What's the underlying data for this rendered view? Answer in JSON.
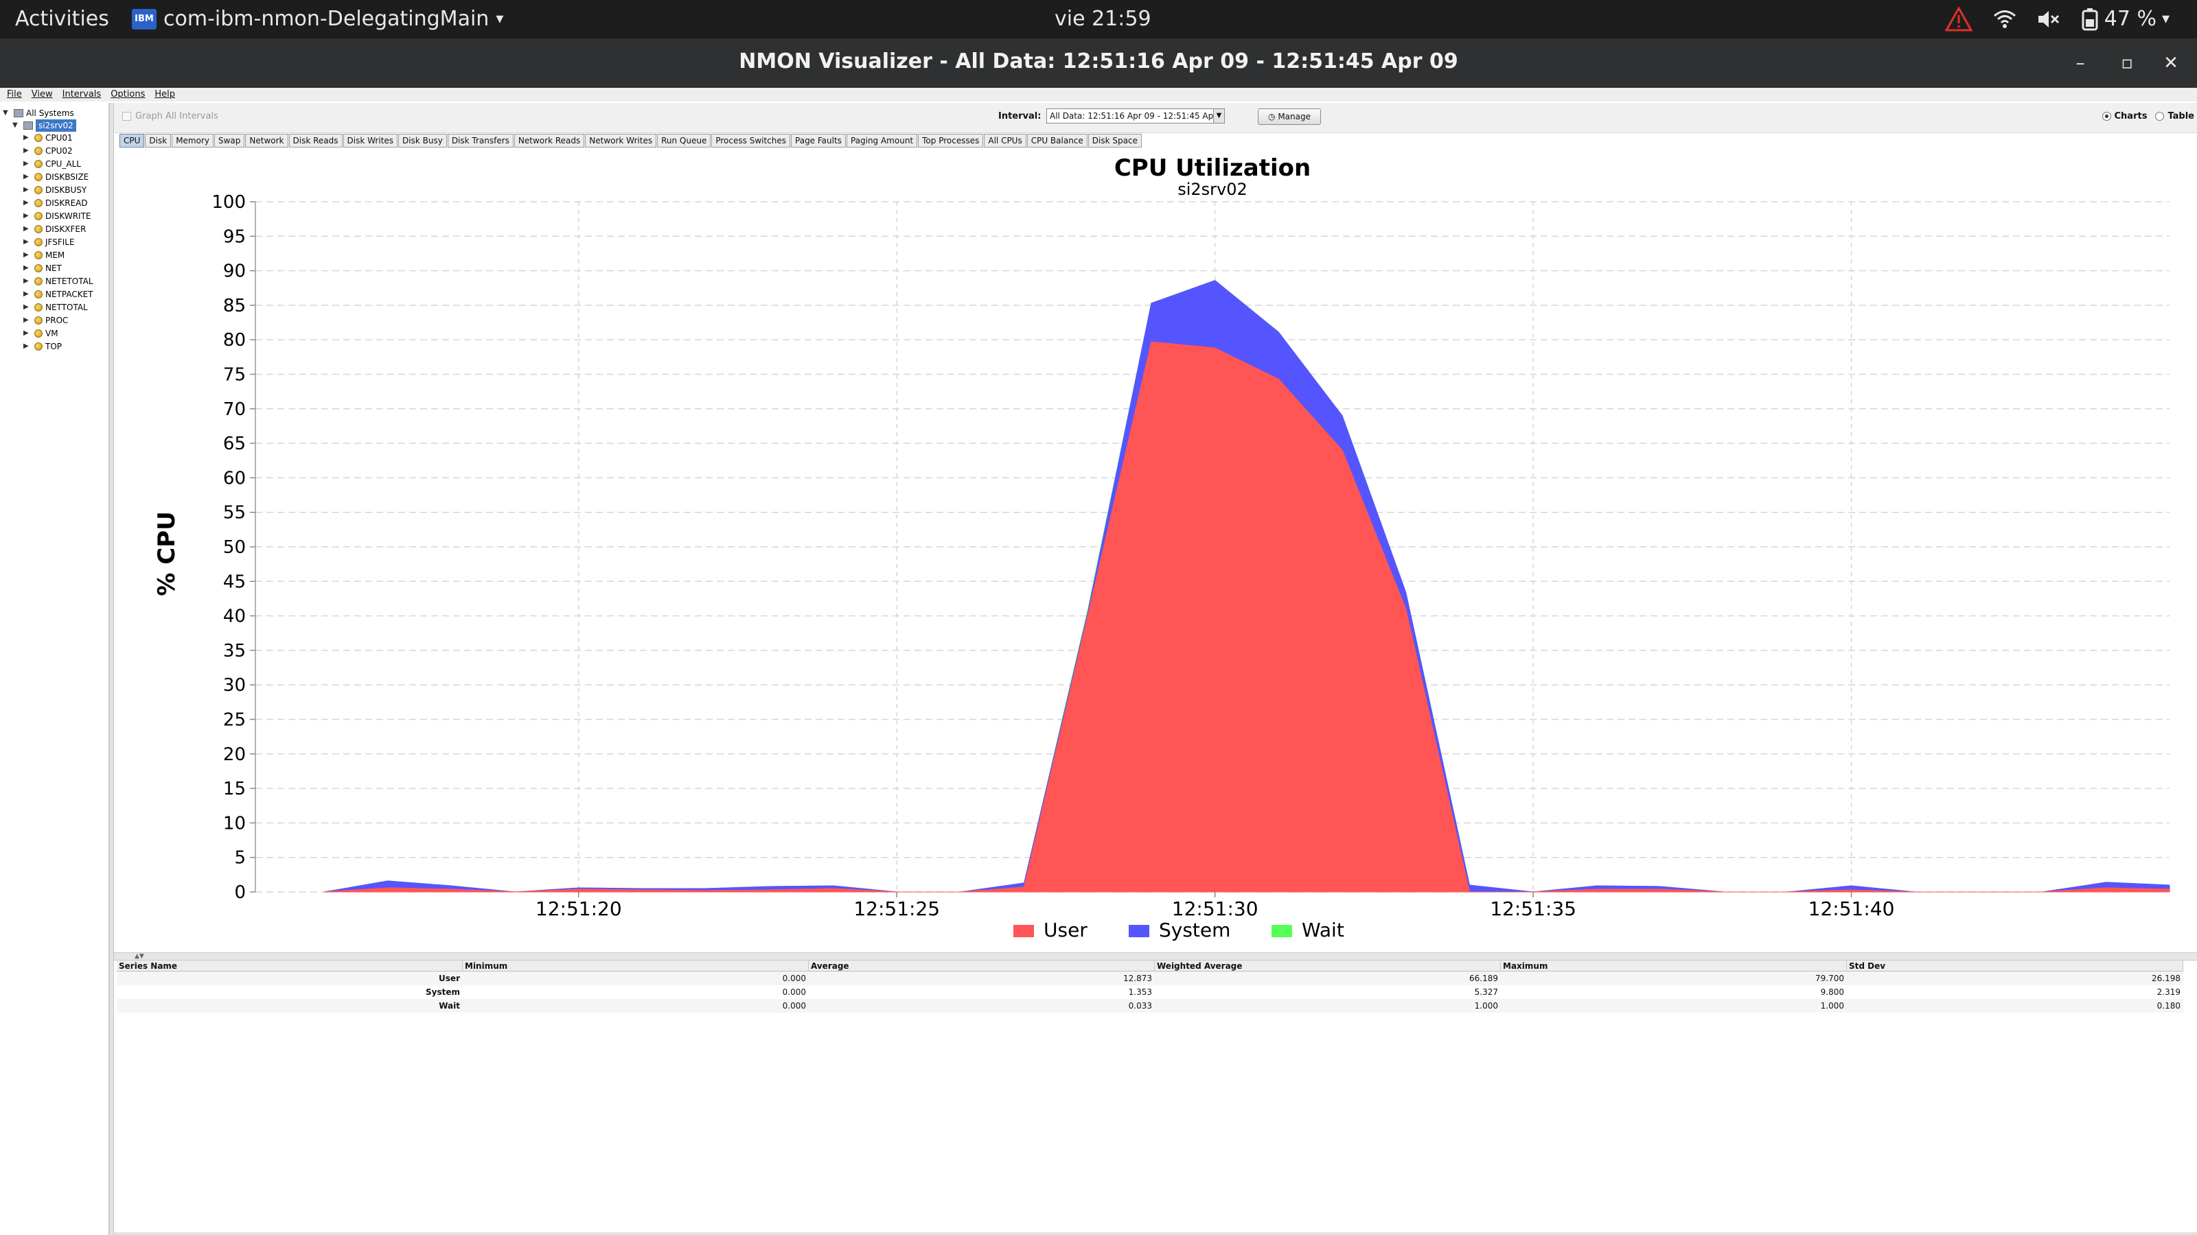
{
  "system_bar": {
    "activities": "Activities",
    "app_name": "com-ibm-nmon-DelegatingMain",
    "app_icon_text": "IBM",
    "clock": "vie 21:59",
    "battery": "47 %"
  },
  "window": {
    "title": "NMON Visualizer - All Data: 12:51:16 Apr 09 - 12:51:45 Apr 09"
  },
  "menu": [
    "File",
    "View",
    "Intervals",
    "Options",
    "Help"
  ],
  "tree": {
    "root": "All Systems",
    "system": "si2srv02",
    "items": [
      "CPU01",
      "CPU02",
      "CPU_ALL",
      "DISKBSIZE",
      "DISKBUSY",
      "DISKREAD",
      "DISKWRITE",
      "DISKXFER",
      "JFSFILE",
      "MEM",
      "NET",
      "NETETOTAL",
      "NETPACKET",
      "NETTOTAL",
      "PROC",
      "VM",
      "TOP"
    ]
  },
  "toolbar": {
    "graph_all": "Graph All Intervals",
    "interval_label": "Interval:",
    "interval_value": "All Data: 12:51:16 Apr 09 - 12:51:45 Apr 09",
    "manage": "Manage",
    "charts": "Charts",
    "table": "Table"
  },
  "tabs": [
    "CPU",
    "Disk",
    "Memory",
    "Swap",
    "Network",
    "Disk Reads",
    "Disk Writes",
    "Disk Busy",
    "Disk Transfers",
    "Network Reads",
    "Network Writes",
    "Run Queue",
    "Process Switches",
    "Page Faults",
    "Paging Amount",
    "Top Processes",
    "All CPUs",
    "CPU Balance",
    "Disk Space"
  ],
  "active_tab": "CPU",
  "chart_data": {
    "type": "area",
    "stacked": true,
    "title": "CPU Utilization",
    "subtitle": "si2srv02",
    "ylabel": "% CPU",
    "xlabel": "",
    "ylim": [
      0,
      100
    ],
    "yticks": [
      0,
      5,
      10,
      15,
      20,
      25,
      30,
      35,
      40,
      45,
      50,
      55,
      60,
      65,
      70,
      75,
      80,
      85,
      90,
      95,
      100
    ],
    "xticks": [
      "12:51:20",
      "12:51:25",
      "12:51:30",
      "12:51:35",
      "12:51:40"
    ],
    "x": [
      "12:51:16",
      "12:51:17",
      "12:51:18",
      "12:51:19",
      "12:51:20",
      "12:51:21",
      "12:51:22",
      "12:51:23",
      "12:51:24",
      "12:51:25",
      "12:51:26",
      "12:51:27",
      "12:51:28",
      "12:51:29",
      "12:51:30",
      "12:51:31",
      "12:51:32",
      "12:51:33",
      "12:51:34",
      "12:51:35",
      "12:51:36",
      "12:51:37",
      "12:51:38",
      "12:51:39",
      "12:51:40",
      "12:51:41",
      "12:51:42",
      "12:51:43",
      "12:51:44",
      "12:51:45"
    ],
    "series": [
      {
        "name": "User",
        "color": "#ff5555",
        "values": [
          0,
          0.6,
          0.4,
          0,
          0.4,
          0.3,
          0.2,
          0.3,
          0.5,
          0,
          0,
          0.7,
          40,
          79.7,
          78.8,
          74.3,
          64.0,
          41.0,
          0,
          0,
          0.4,
          0.4,
          0,
          0,
          0.3,
          0,
          0,
          0,
          0.6,
          0.4
        ]
      },
      {
        "name": "System",
        "color": "#5555ff",
        "values": [
          0,
          1.0,
          0.5,
          0,
          0.2,
          0.2,
          0.3,
          0.5,
          0.4,
          0,
          0,
          0.6,
          0.5,
          5.6,
          9.8,
          6.8,
          5.0,
          2.4,
          1.0,
          0,
          0.5,
          0.4,
          0,
          0,
          0.6,
          0,
          0,
          0,
          0.8,
          0.6
        ]
      },
      {
        "name": "Wait",
        "color": "#55ff55",
        "values": [
          0,
          0,
          0,
          0,
          0,
          0,
          0,
          0,
          0,
          0,
          0,
          0,
          0.3,
          0,
          0,
          0,
          0,
          0,
          0,
          0,
          0,
          0,
          0,
          0,
          0,
          0,
          0,
          0,
          0,
          0
        ]
      }
    ],
    "legend_position": "bottom",
    "grid": true
  },
  "stats": {
    "headers": [
      "Series Name",
      "Minimum",
      "Average",
      "Weighted Average",
      "Maximum",
      "Std Dev"
    ],
    "rows": [
      [
        "User",
        "0.000",
        "12.873",
        "66.189",
        "79.700",
        "26.198"
      ],
      [
        "System",
        "0.000",
        "1.353",
        "5.327",
        "9.800",
        "2.319"
      ],
      [
        "Wait",
        "0.000",
        "0.033",
        "1.000",
        "1.000",
        "0.180"
      ]
    ]
  }
}
